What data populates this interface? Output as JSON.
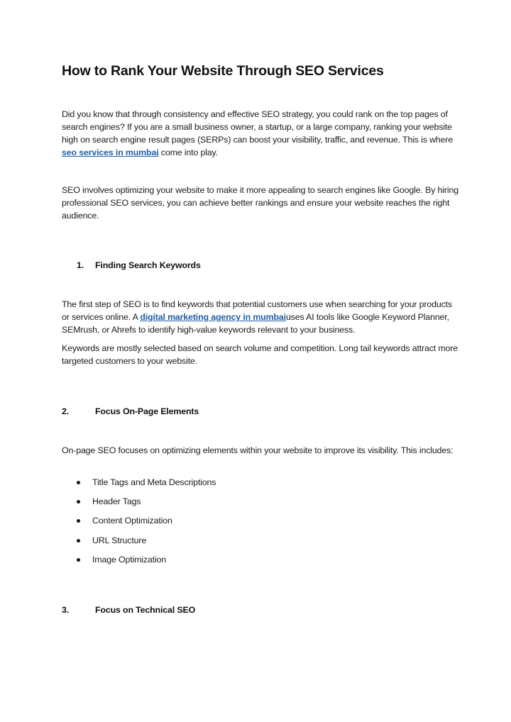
{
  "document": {
    "title": "How to Rank Your Website Through SEO Services",
    "intro": {
      "before_link": "Did you know that through consistency and effective SEO strategy, you could rank on the top pages of search engines? If you are a small business owner, a startup, or a large company, ranking your website high on search engine result pages (SERPs) can boost your visibility, traffic, and revenue. This is where ",
      "link_text": "seo services in mumbai",
      "after_link": " come into play."
    },
    "para2": "SEO involves optimizing your website to make it more appealing to search engines like Google. By hiring professional SEO services, you can achieve better rankings and ensure your website reaches the right audience.",
    "sections": [
      {
        "number": "1.",
        "heading": "Finding Search Keywords",
        "para1": {
          "before_link": "The first step of SEO is to find keywords that potential customers use when searching for your products or services online. A ",
          "link_text": "digital marketing agency in mumbai",
          "after_link": "uses AI tools like Google Keyword Planner, SEMrush, or Ahrefs to identify high-value keywords relevant to your business."
        },
        "para2": "Keywords are mostly selected based on search volume and competition. Long tail keywords attract more targeted customers to your website."
      },
      {
        "number": "2.",
        "heading": "Focus On-Page Elements",
        "para1": "On-page SEO focuses on optimizing elements within your website to improve its visibility. This includes:",
        "bullets": [
          "Title Tags and Meta Descriptions",
          "Header Tags",
          "Content Optimization",
          "URL Structure",
          "Image Optimization"
        ]
      },
      {
        "number": "3.",
        "heading": "Focus on Technical SEO"
      }
    ],
    "colors": {
      "link": "#1f5fa8",
      "text": "#1a1a1a"
    }
  }
}
